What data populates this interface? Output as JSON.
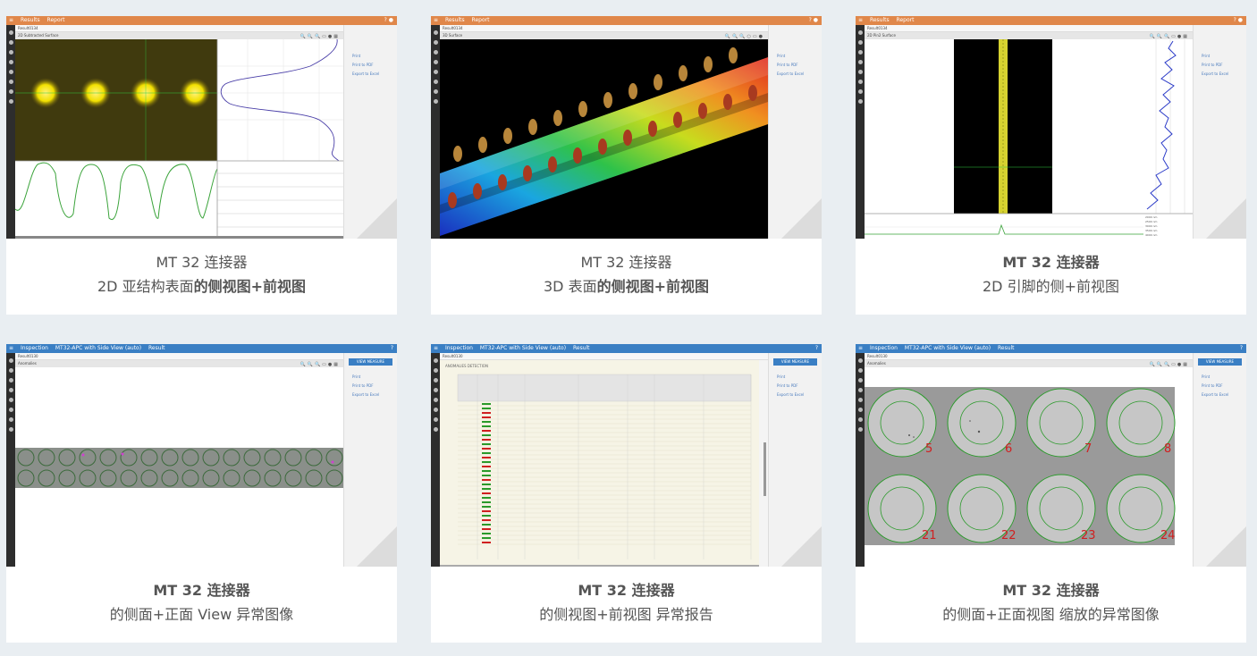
{
  "cards": [
    {
      "app": {
        "tabs": [
          "Results",
          "Report"
        ],
        "breadcrumb": "Result0134",
        "view_name": "2D Subtracted Surface"
      },
      "caption": {
        "line1_plain": "MT 32 连接器",
        "line1_bold": "",
        "line2_plain": "2D 亚结构表面",
        "line2_bold": "的侧视图+前视图"
      }
    },
    {
      "app": {
        "tabs": [
          "Results",
          "Report"
        ],
        "breadcrumb": "Result0134",
        "view_name": "3D Surface"
      },
      "caption": {
        "line1_plain": "MT 32 连接器",
        "line1_bold": "",
        "line2_plain": "3D 表面",
        "line2_bold": "的侧视图+前视图"
      }
    },
    {
      "app": {
        "tabs": [
          "Results",
          "Report"
        ],
        "breadcrumb": "Result0134",
        "view_name": "2D Pin2 Surface"
      },
      "caption": {
        "line1_plain": "",
        "line1_bold": "MT 32 连接器",
        "line2_plain": "2D 引脚的侧+前视图",
        "line2_bold": ""
      }
    },
    {
      "app": {
        "tabs": [
          "Inspection",
          "MT32-APC with Side View (auto)",
          "Result"
        ],
        "breadcrumb": "Result0130",
        "view_name": "Anomalies",
        "button": "VIEW MEASURE"
      },
      "caption": {
        "line1_plain": "",
        "line1_bold": "MT 32 连接器",
        "line2_plain": "的侧面+正面 View 异常图像",
        "line2_bold": ""
      }
    },
    {
      "app": {
        "tabs": [
          "Inspection",
          "MT32-APC with Side View (auto)",
          "Result"
        ],
        "breadcrumb": "Result0130",
        "view_name": "ANOMALIES DETECTION"
      },
      "caption": {
        "line1_plain": "",
        "line1_bold": "MT 32 连接器",
        "line2_plain": "的侧视图+前视图 异常报告",
        "line2_bold": ""
      }
    },
    {
      "app": {
        "tabs": [
          "Inspection",
          "MT32-APC with Side View (auto)",
          "Result"
        ],
        "breadcrumb": "Result0130",
        "view_name": "Anomalies",
        "button": "VIEW MEASURE"
      },
      "caption": {
        "line1_plain": "",
        "line1_bold": "MT 32 连接器",
        "line2_plain": "的侧面+正面视图 缩放的异常图像",
        "line2_bold": ""
      },
      "fiber_labels": [
        "5",
        "6",
        "7",
        "8",
        "21",
        "22",
        "23",
        "24"
      ]
    }
  ],
  "side_links": [
    "Print",
    "Print to PDF",
    "Export to Excel"
  ],
  "colors": {
    "orange_bar": "#e0874a",
    "blue_bar": "#3a7fc4",
    "page_bg": "#e9eef2",
    "pass": "#2a9a2a",
    "fail": "#d02020"
  }
}
